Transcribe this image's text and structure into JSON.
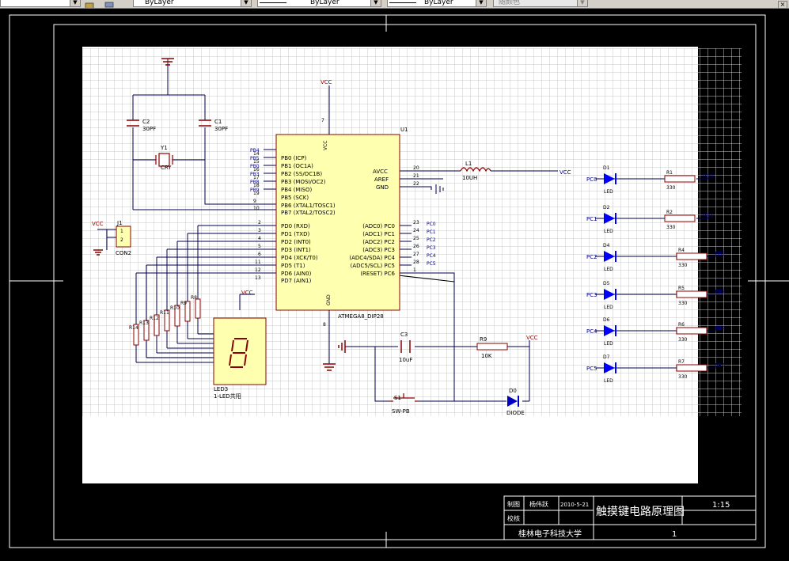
{
  "toolbar": {
    "color_layer_label": "ByLayer",
    "linetype_label": "ByLayer",
    "lineweight_label": "ByLayer",
    "plotstyle_label": "随颜色"
  },
  "schematic": {
    "mcu_ref": "U1",
    "mcu_part": "ATMEGA8_DIP28",
    "vcc": "VCC",
    "gnd": "GND",
    "port_b_pins": [
      "PB0 (ICP)",
      "PB1 (OC1A)",
      "PB2 (SS/OC1B)",
      "PB3 (MOSI/OC2)",
      "PB4 (MISO)",
      "PB5 (SCK)",
      "PB6 (XTAL1/TOSC1)",
      "PB7 (XTAL2/TOSC2)"
    ],
    "port_b_nums": [
      "14",
      "15",
      "16",
      "17",
      "18",
      "19",
      "9",
      "10"
    ],
    "port_b_nets": [
      "PB4",
      "PB5",
      "PB0",
      "PB3",
      "PB8",
      "PB9"
    ],
    "port_d_pins": [
      "PD0 (RXD)",
      "PD1 (TXD)",
      "PD2 (INT0)",
      "PD3 (INT1)",
      "PD4 (XCK/T0)",
      "PD5 (T1)",
      "PD6 (AIN0)",
      "PD7 (AIN1)"
    ],
    "port_d_nums": [
      "2",
      "3",
      "4",
      "5",
      "6",
      "11",
      "12",
      "13"
    ],
    "port_c_pins": [
      "(ADC0) PC0",
      "(ADC1) PC1",
      "(ADC2) PC2",
      "(ADC3) PC3",
      "(ADC4/SDA) PC4",
      "(ADC5/SCL) PC5",
      "(RESET) PC6"
    ],
    "port_c_nums": [
      "23",
      "24",
      "25",
      "26",
      "27",
      "28",
      "1"
    ],
    "port_c_nets": [
      "PC0",
      "PC1",
      "PC2",
      "PC3",
      "PC4",
      "PC5"
    ],
    "power_pins": [
      "AVCC",
      "AREF",
      "GND"
    ],
    "power_nums": [
      "20",
      "21",
      "22"
    ],
    "vcc_pin_num": "7",
    "gnd_pin_num": "8",
    "crystal_ref": "Y1",
    "crystal_val": "CRY",
    "c1_ref": "C1",
    "c1_val": "30PF",
    "c2_ref": "C2",
    "c2_val": "30PF",
    "c3_ref": "C3",
    "c3_val": "10uF",
    "l1_ref": "L1",
    "l1_val": "10UH",
    "r9_ref": "R9",
    "r9_val": "10K",
    "j1_ref": "J1",
    "j1_val": "CON2",
    "s1_ref": "S1",
    "s1_val": "SW-PB",
    "d0_ref": "D0",
    "d0_val": "DIODE",
    "led7_ref": "LED3",
    "led7_val": "1-LED共阳",
    "res_array": [
      "R8",
      "R9",
      "R10",
      "R11",
      "R12",
      "R13",
      "R14"
    ],
    "leds": [
      {
        "net_in": "PC0",
        "ref": "D1",
        "val": "LED",
        "r_ref": "R1",
        "r_val": "330",
        "net_out": "PB0"
      },
      {
        "net_in": "PC1",
        "ref": "D2",
        "val": "LED",
        "r_ref": "R2",
        "r_val": "330",
        "net_out": "PB1"
      },
      {
        "net_in": "PC2",
        "ref": "D4",
        "val": "LED",
        "r_ref": "R4",
        "r_val": "330",
        "net_out": "PB2"
      },
      {
        "net_in": "PC3",
        "ref": "D5",
        "val": "LED",
        "r_ref": "R5",
        "r_val": "330",
        "net_out": "PB3"
      },
      {
        "net_in": "PC4",
        "ref": "D6",
        "val": "LED",
        "r_ref": "R6",
        "r_val": "330",
        "net_out": "PB4"
      },
      {
        "net_in": "PC5",
        "ref": "D7",
        "val": "LED",
        "r_ref": "R7",
        "r_val": "330",
        "net_out": "PB5"
      }
    ]
  },
  "title_block": {
    "drawn_label": "制图",
    "drawn_by": "杨伟跃",
    "date": "2010-5-21",
    "check_label": "校核",
    "title": "触摸键电路原理图",
    "scale": "1:15",
    "school": "桂林电子科技大学",
    "sheet": "1"
  },
  "colors": {
    "canvas": "#000000",
    "sheet": "#ffffff",
    "grid": "#c8c8c8",
    "wire": "#00004e",
    "component": "#8b0000",
    "net_label": "#000080",
    "body_fill": "#ffffb0",
    "led": "#0000ff"
  }
}
